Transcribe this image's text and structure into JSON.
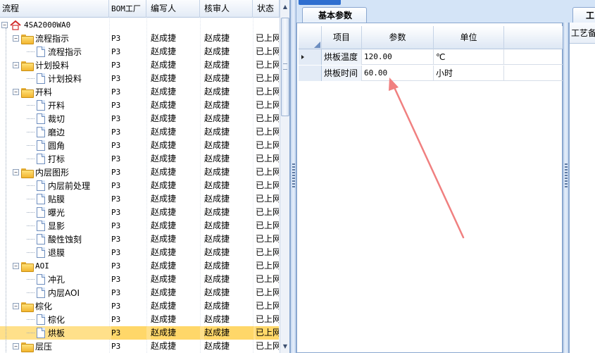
{
  "tree": {
    "columns": [
      {
        "label": "流程"
      },
      {
        "label": "BOM工厂"
      },
      {
        "label": "编写人"
      },
      {
        "label": "核审人"
      },
      {
        "label": "状态"
      }
    ],
    "root": {
      "label": "4SA2000WA0"
    },
    "rows": [
      {
        "label": "流程指示",
        "kind": "folder",
        "bom": "P3",
        "author": "赵成捷",
        "reviewer": "赵成捷",
        "status": "已上网"
      },
      {
        "label": "流程指示",
        "kind": "doc",
        "bom": "P3",
        "author": "赵成捷",
        "reviewer": "赵成捷",
        "status": "已上网"
      },
      {
        "label": "计划投料",
        "kind": "folder",
        "bom": "P3",
        "author": "赵成捷",
        "reviewer": "赵成捷",
        "status": "已上网"
      },
      {
        "label": "计划投料",
        "kind": "doc",
        "bom": "P3",
        "author": "赵成捷",
        "reviewer": "赵成捷",
        "status": "已上网"
      },
      {
        "label": "开料",
        "kind": "folder",
        "bom": "P3",
        "author": "赵成捷",
        "reviewer": "赵成捷",
        "status": "已上网"
      },
      {
        "label": "开料",
        "kind": "doc",
        "bom": "P3",
        "author": "赵成捷",
        "reviewer": "赵成捷",
        "status": "已上网"
      },
      {
        "label": "裁切",
        "kind": "doc",
        "bom": "P3",
        "author": "赵成捷",
        "reviewer": "赵成捷",
        "status": "已上网"
      },
      {
        "label": "磨边",
        "kind": "doc",
        "bom": "P3",
        "author": "赵成捷",
        "reviewer": "赵成捷",
        "status": "已上网"
      },
      {
        "label": "圆角",
        "kind": "doc",
        "bom": "P3",
        "author": "赵成捷",
        "reviewer": "赵成捷",
        "status": "已上网"
      },
      {
        "label": "打标",
        "kind": "doc",
        "bom": "P3",
        "author": "赵成捷",
        "reviewer": "赵成捷",
        "status": "已上网"
      },
      {
        "label": "内层图形",
        "kind": "folder",
        "bom": "P3",
        "author": "赵成捷",
        "reviewer": "赵成捷",
        "status": "已上网"
      },
      {
        "label": "内层前处理",
        "kind": "doc",
        "bom": "P3",
        "author": "赵成捷",
        "reviewer": "赵成捷",
        "status": "已上网"
      },
      {
        "label": "贴膜",
        "kind": "doc",
        "bom": "P3",
        "author": "赵成捷",
        "reviewer": "赵成捷",
        "status": "已上网"
      },
      {
        "label": "曝光",
        "kind": "doc",
        "bom": "P3",
        "author": "赵成捷",
        "reviewer": "赵成捷",
        "status": "已上网"
      },
      {
        "label": "显影",
        "kind": "doc",
        "bom": "P3",
        "author": "赵成捷",
        "reviewer": "赵成捷",
        "status": "已上网"
      },
      {
        "label": "酸性蚀刻",
        "kind": "doc",
        "bom": "P3",
        "author": "赵成捷",
        "reviewer": "赵成捷",
        "status": "已上网"
      },
      {
        "label": "退膜",
        "kind": "doc",
        "bom": "P3",
        "author": "赵成捷",
        "reviewer": "赵成捷",
        "status": "已上网"
      },
      {
        "label": "AOI",
        "kind": "folder",
        "bom": "P3",
        "author": "赵成捷",
        "reviewer": "赵成捷",
        "status": "已上网"
      },
      {
        "label": "冲孔",
        "kind": "doc",
        "bom": "P3",
        "author": "赵成捷",
        "reviewer": "赵成捷",
        "status": "已上网"
      },
      {
        "label": "内层AOI",
        "kind": "doc",
        "bom": "P3",
        "author": "赵成捷",
        "reviewer": "赵成捷",
        "status": "已上网"
      },
      {
        "label": "棕化",
        "kind": "folder",
        "bom": "P3",
        "author": "赵成捷",
        "reviewer": "赵成捷",
        "status": "已上网"
      },
      {
        "label": "棕化",
        "kind": "doc",
        "bom": "P3",
        "author": "赵成捷",
        "reviewer": "赵成捷",
        "status": "已上网"
      },
      {
        "label": "烘板",
        "kind": "doc",
        "bom": "P3",
        "author": "赵成捷",
        "reviewer": "赵成捷",
        "status": "已上网",
        "selected": true
      },
      {
        "label": "层压",
        "kind": "folder",
        "bom": "P3",
        "author": "赵成捷",
        "reviewer": "赵成捷",
        "status": "已上网"
      }
    ]
  },
  "right": {
    "tab_label": "基本参数",
    "side_tab_label": "工",
    "side_panel_label": "工艺备注",
    "grid": {
      "headers": {
        "item": "项目",
        "value": "参数",
        "unit": "单位"
      },
      "rows": [
        {
          "item": "烘板温度",
          "value": "120.00",
          "unit": "℃",
          "current": true
        },
        {
          "item": "烘板时间",
          "value": "60.00",
          "unit": "小时"
        }
      ]
    }
  },
  "icons": {
    "root": "home-icon",
    "folder": "folder-icon",
    "doc": "document-icon",
    "annotation": "red-arrow-annotation"
  },
  "colors": {
    "selected_row": "#ffd769",
    "accent": "#2f6fd0",
    "annotation_arrow": "#f08080"
  }
}
